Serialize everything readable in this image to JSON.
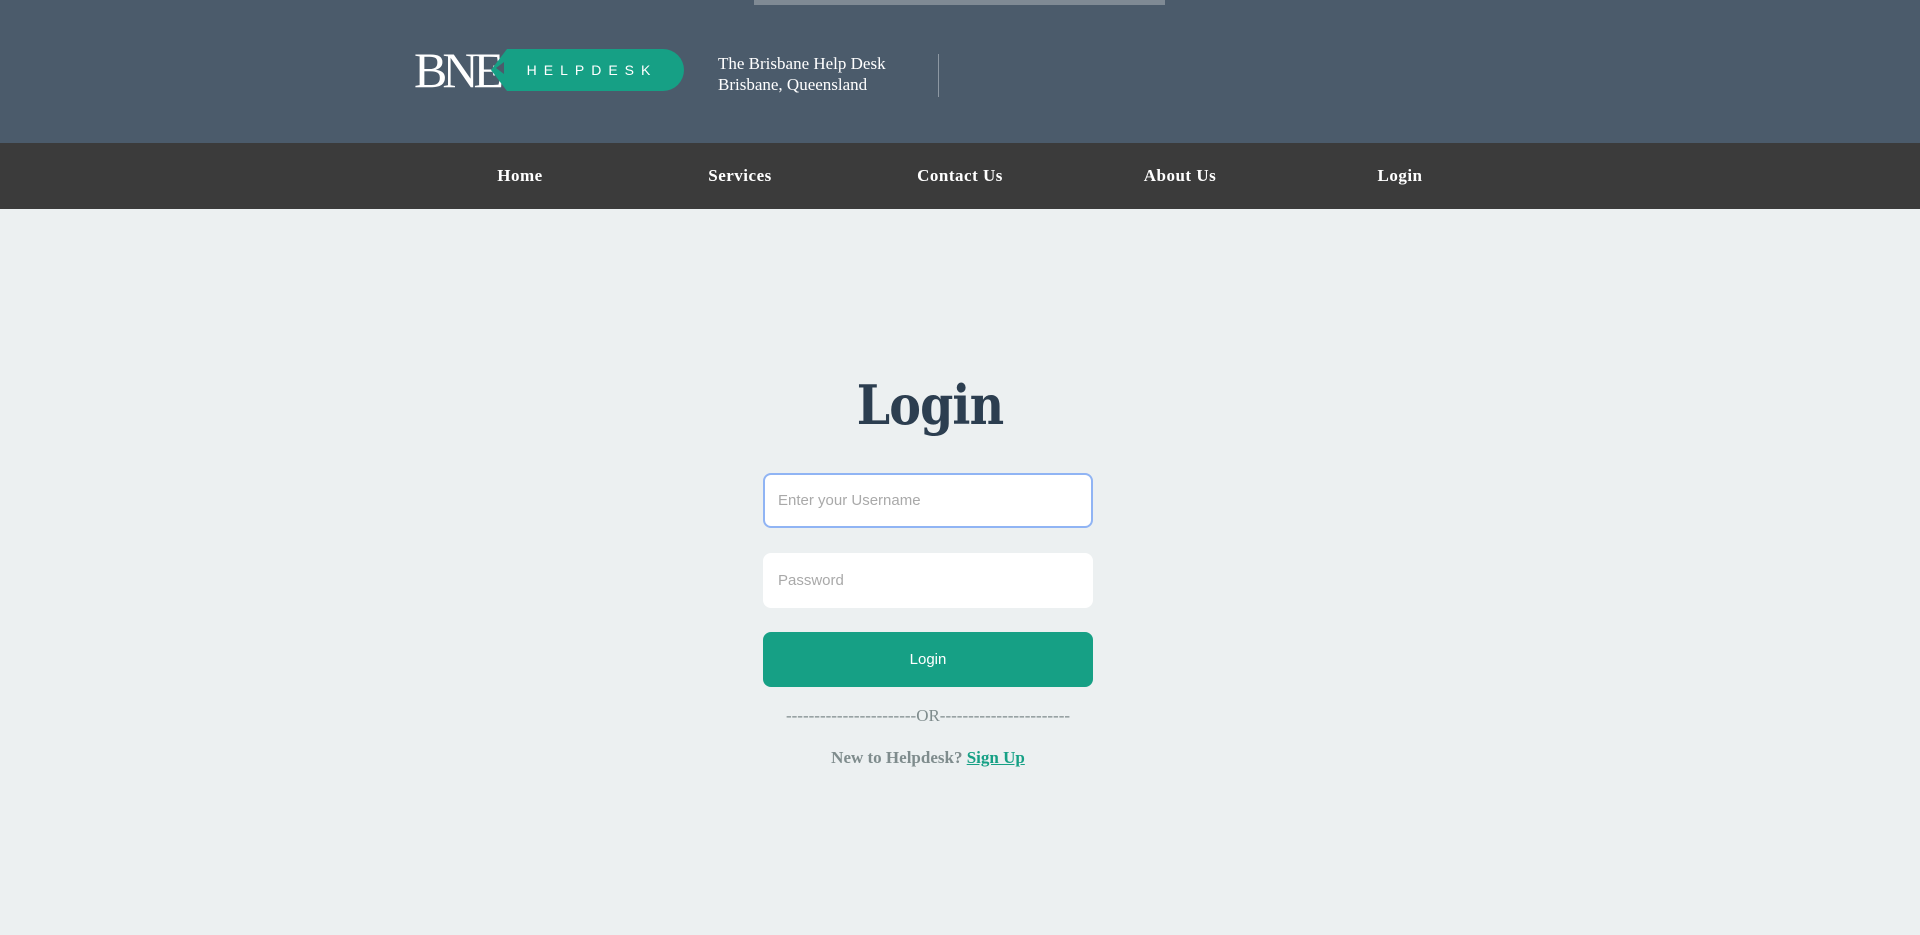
{
  "header": {
    "logo": {
      "main_text": "BNE",
      "badge_text": "HELPDESK"
    },
    "tagline_line1": "The Brisbane Help Desk",
    "tagline_line2": "Brisbane, Queensland"
  },
  "nav": {
    "items": [
      {
        "label": "Home"
      },
      {
        "label": "Services"
      },
      {
        "label": "Contact Us"
      },
      {
        "label": "About Us"
      },
      {
        "label": "Login"
      }
    ]
  },
  "login_form": {
    "title": "Login",
    "username": {
      "value": "",
      "placeholder": "Enter your Username"
    },
    "password": {
      "value": "",
      "placeholder": "Password"
    },
    "submit_label": "Login",
    "separator": "-----------------------OR-----------------------",
    "signup_prompt": "New to Helpdesk?",
    "signup_link": "Sign Up"
  },
  "colors": {
    "header_bg": "#4b5b6b",
    "nav_bg": "#3b3b3b",
    "page_bg": "#ecf0f1",
    "accent": "#16a085",
    "title": "#2c3e50"
  }
}
